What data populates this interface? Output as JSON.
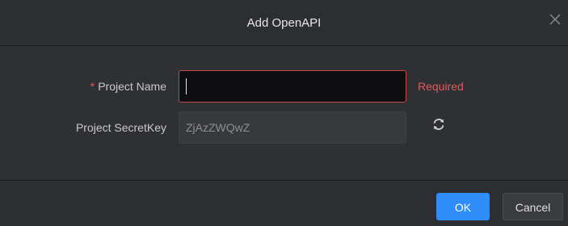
{
  "dialog": {
    "title": "Add OpenAPI",
    "close_icon": "close-icon"
  },
  "form": {
    "project_name": {
      "required_marker": "*",
      "label": "Project Name",
      "value": "",
      "error": "Required"
    },
    "secret_key": {
      "label": "Project SecretKey",
      "value": "ZjAzZWQwZ",
      "refresh_icon": "refresh-icon"
    }
  },
  "footer": {
    "ok_label": "OK",
    "cancel_label": "Cancel"
  },
  "colors": {
    "accent": "#2f8dfa",
    "error": "#e05a5a",
    "background": "#2f3034"
  }
}
